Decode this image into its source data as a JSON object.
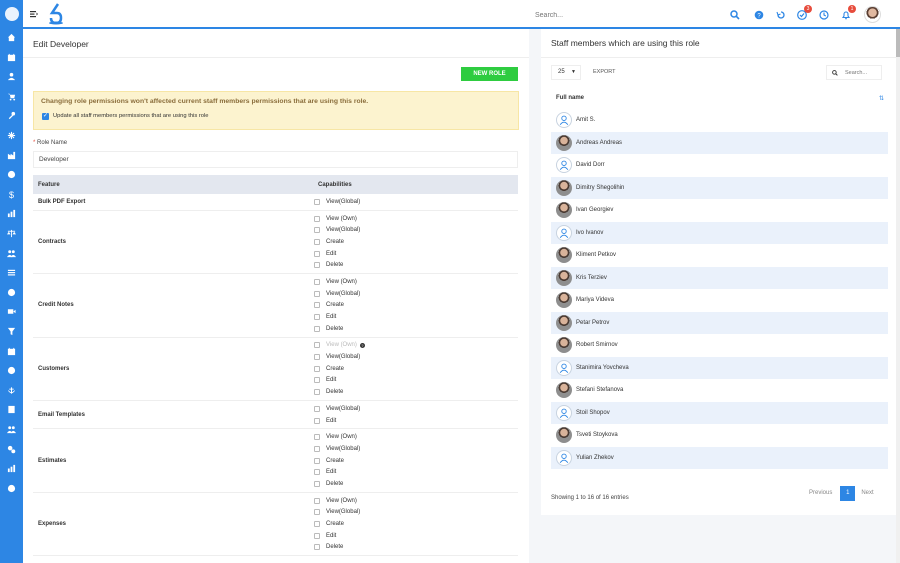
{
  "topbar": {
    "search_placeholder": "Search...",
    "tasks_badge": "3",
    "notifications_badge": "1"
  },
  "left": {
    "title": "Edit Developer",
    "new_role_label": "NEW ROLE",
    "alert_title": "Changing role permissions won't affected current staff members permissions that are using this role.",
    "alert_checkbox_label": "Update all staff members permissions that are using this role",
    "role_name_label": "Role Name",
    "role_name_value": "Developer",
    "table": {
      "col_feature": "Feature",
      "col_capabilities": "Capabilities",
      "rows": [
        {
          "feature": "Bulk PDF Export",
          "caps": [
            "View(Global)"
          ]
        },
        {
          "feature": "Contracts",
          "caps": [
            "View (Own)",
            "View(Global)",
            "Create",
            "Edit",
            "Delete"
          ]
        },
        {
          "feature": "Credit Notes",
          "caps": [
            "View (Own)",
            "View(Global)",
            "Create",
            "Edit",
            "Delete"
          ]
        },
        {
          "feature": "Customers",
          "caps": [
            "View (Own)",
            "View(Global)",
            "Create",
            "Edit",
            "Delete"
          ]
        },
        {
          "feature": "Email Templates",
          "caps": [
            "View(Global)",
            "Edit"
          ]
        },
        {
          "feature": "Estimates",
          "caps": [
            "View (Own)",
            "View(Global)",
            "Create",
            "Edit",
            "Delete"
          ]
        },
        {
          "feature": "Expenses",
          "caps": [
            "View (Own)",
            "View(Global)",
            "Create",
            "Edit",
            "Delete"
          ]
        }
      ]
    }
  },
  "right": {
    "title": "Staff members which are using this role",
    "page_length": "25",
    "export_label": "EXPORT",
    "search_placeholder": "Search...",
    "col_full_name": "Full name",
    "staff": [
      {
        "name": "Amit S.",
        "photo": false
      },
      {
        "name": "Andreas Andreas",
        "photo": true
      },
      {
        "name": "David Dorr",
        "photo": false
      },
      {
        "name": "Dimitry Shegolihin",
        "photo": true
      },
      {
        "name": "Ivan Georgiev",
        "photo": true
      },
      {
        "name": "Ivo Ivanov",
        "photo": false
      },
      {
        "name": "Kliment Petkov",
        "photo": true
      },
      {
        "name": "Kris Terziev",
        "photo": true
      },
      {
        "name": "Mariya Videva",
        "photo": true
      },
      {
        "name": "Petar Petrov",
        "photo": true
      },
      {
        "name": "Robert Smirnov",
        "photo": true
      },
      {
        "name": "Stanimira Yovcheva",
        "photo": false
      },
      {
        "name": "Stefani Stefanova",
        "photo": true
      },
      {
        "name": "Stoil Shopov",
        "photo": false
      },
      {
        "name": "Tsveti Stoykova",
        "photo": true
      },
      {
        "name": "Yulian Zhekov",
        "photo": false
      }
    ],
    "showing_text": "Showing 1 to 16 of 16 entries",
    "prev_label": "Previous",
    "current_page": "1",
    "next_label": "Next"
  },
  "colors": {
    "primary": "#2d86e4",
    "success": "#2ecc40",
    "alert_bg": "#fcf3cf",
    "badge": "#e74c3c"
  },
  "sidebar_icons": [
    "home-icon",
    "calendar-icon",
    "user-icon",
    "cart-icon",
    "wrench-icon",
    "snowflake-icon",
    "factory-icon",
    "globe-icon",
    "dollar-icon",
    "chart-icon",
    "balance-icon",
    "group-icon",
    "list-icon",
    "help-icon",
    "video-icon",
    "filter-icon",
    "calendar-icon",
    "user-circle-icon",
    "anchor-icon",
    "contact-icon",
    "group-icon",
    "cogs-icon",
    "chart-icon",
    "settings-icon"
  ]
}
